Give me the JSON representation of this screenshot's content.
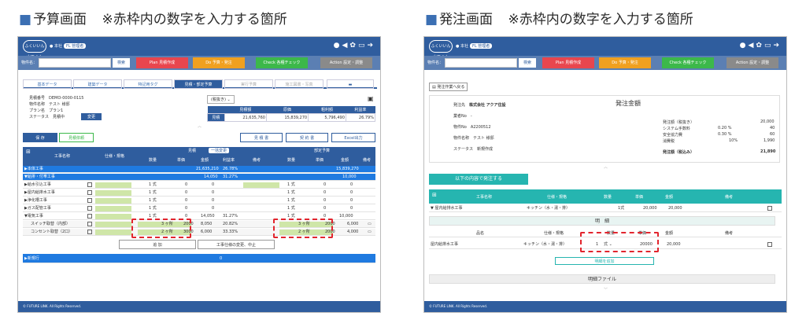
{
  "captions": {
    "left": {
      "bullet": "■",
      "title": "予算画面",
      "note": "※赤枠内の数字を入力する箇所"
    },
    "right": {
      "bullet": "■",
      "title": "発注画面",
      "note": "※赤枠内の数字を入力する箇所"
    }
  },
  "app": {
    "logo": "ふくいいん山でくん",
    "branch": "本社",
    "user": "FL 管理者",
    "property_label": "物件名：",
    "search_btn": "検索",
    "actions": [
      {
        "label": "Plan 見積作成",
        "color": "#e8464e"
      },
      {
        "label": "Do 予算・発注",
        "color": "#f0a020"
      },
      {
        "label": "Check 各種チェック",
        "color": "#3cb84a"
      },
      {
        "label": "Action 設定・調整",
        "color": "#8a8a8a"
      }
    ],
    "footer": "© FUTURE LINK. All Rights Reserved.",
    "colors": {
      "primary": "#2f5d9e",
      "teal": "#26b5b0",
      "red_box": "#e2252e",
      "green_cell": "#cfe6a8"
    }
  },
  "budget": {
    "tabs": [
      "基本データ",
      "建築データ",
      "特記用タグ",
      "見積・部定予算",
      "実行予算",
      "施工図書・写真"
    ],
    "tab_icon": "folder-icon",
    "info": [
      {
        "k": "見積番号",
        "v": "DEMO-0000-0115"
      },
      {
        "k": "物件名称",
        "v": "テスト 様邸"
      },
      {
        "k": "プラン名",
        "v": "プラン1"
      },
      {
        "k": "ステータス",
        "v": "見積中"
      }
    ],
    "change_btn": "変更",
    "tax_select": "(税抜き)",
    "summary": {
      "headers": [
        "",
        "見積額",
        "原価",
        "粗利額",
        "利益率"
      ],
      "row": [
        "見積",
        "21,635,760",
        "15,839,270",
        "5,796,490",
        "26.79%"
      ]
    },
    "save": "保 存",
    "request": "見積依頼",
    "doc_btns": [
      "見 積 書",
      "契 約 書",
      "Excel出力"
    ],
    "grid_headers": {
      "name": "工事名称",
      "spec": "仕様・規格",
      "estimate": "見積",
      "budget": "部定予算",
      "qty": "数量",
      "unit_price": "単価",
      "amount": "金額",
      "rate": "利益率",
      "note": "備考",
      "toggle": "一括変更"
    },
    "rows": [
      {
        "name": "▶本体工事",
        "amount": "21,635,210",
        "rate": "26.78%",
        "b_amount": "15,839,270",
        "blue": true
      },
      {
        "name": "▼給排・付帯工事",
        "amount": "14,050",
        "rate": "31.27%",
        "b_amount": "10,000",
        "blue": true
      },
      {
        "name": "▶給水引込工事",
        "qty": "1 式",
        "up": "0",
        "amt": "0",
        "bqty": "1 式",
        "bup": "0",
        "bamt": "0"
      },
      {
        "name": "▶屋内給排水工事",
        "qty": "1 式",
        "up": "0",
        "amt": "0",
        "bqty": "1 式",
        "bup": "0",
        "bamt": "0"
      },
      {
        "name": "▶浄化槽工事",
        "qty": "1 式",
        "up": "0",
        "amt": "0",
        "bqty": "1 式",
        "bup": "0",
        "bamt": "0"
      },
      {
        "name": "▶ガス配管工事",
        "qty": "1 式",
        "up": "0",
        "amt": "0",
        "bqty": "1 式",
        "bup": "0",
        "bamt": "0"
      },
      {
        "name": "▼電気工事",
        "qty": "1 式",
        "up": "0",
        "amt": "14,050",
        "rate": "31.27%",
        "bqty": "1 式",
        "bup": "0",
        "bamt": "10,000"
      },
      {
        "name": "スイッチ取替（内部）",
        "qty": "3 ヶ所",
        "up": "2000",
        "amt": "8,050",
        "rate": "20.82%",
        "bqty": "3 ヶ所",
        "bup": "2000",
        "bamt": "6,000"
      },
      {
        "name": "コンセント取替（2口）",
        "qty": "2 ヶ所",
        "up": "3000",
        "amt": "6,000",
        "rate": "33.33%",
        "bqty": "2 ヶ所",
        "bup": "2000",
        "bamt": "4,000"
      }
    ],
    "add_btn": "追 加",
    "change_cancel": "工事仕様の変更、中止",
    "last_row": "▶新規行"
  },
  "order": {
    "back_btn": "発注作業へ戻る",
    "info": [
      {
        "k": "発注先",
        "v": "株式会社 アクア住設"
      },
      {
        "k": "業者No",
        "v": "-"
      },
      {
        "k": "物件No",
        "v": "A2200512"
      },
      {
        "k": "物件名称",
        "v": "テスト 様邸"
      },
      {
        "k": "ステータス",
        "v": "新規作成"
      }
    ],
    "amount_title": "発注金額",
    "amounts": [
      {
        "k": "発注額（税抜き）",
        "v": "20,000"
      },
      {
        "k": "システム手数料",
        "p": "0.20 %",
        "v": "40"
      },
      {
        "k": "安全協力費",
        "p": "0.30 %",
        "v": "60"
      },
      {
        "k": "消費税",
        "p": "10%",
        "v": "1,990"
      },
      {
        "k": "発注額（税込み）",
        "v": "21,890"
      }
    ],
    "submit_btn": "以下の内容で発注する",
    "grid_headers": [
      "工事名称",
      "仕様・規格",
      "数量",
      "単価",
      "金額",
      "備考"
    ],
    "main_row": {
      "name": "屋内給排水工事",
      "spec": "キッチン（水・湯・排）",
      "qty": "1式",
      "up": "20,000",
      "amt": "20,000"
    },
    "detail_title": "明　細",
    "detail_headers": [
      "品名",
      "仕様・規格",
      "数量",
      "単価",
      "金額",
      "備考"
    ],
    "detail_row": {
      "name": "屋内給排水工事",
      "spec": "キッチン（水・湯・排）",
      "qty": "1",
      "unit": "式",
      "up": "20000",
      "amt": "20,000"
    },
    "add_detail": "明細を追加",
    "file_title": "明細ファイル"
  }
}
